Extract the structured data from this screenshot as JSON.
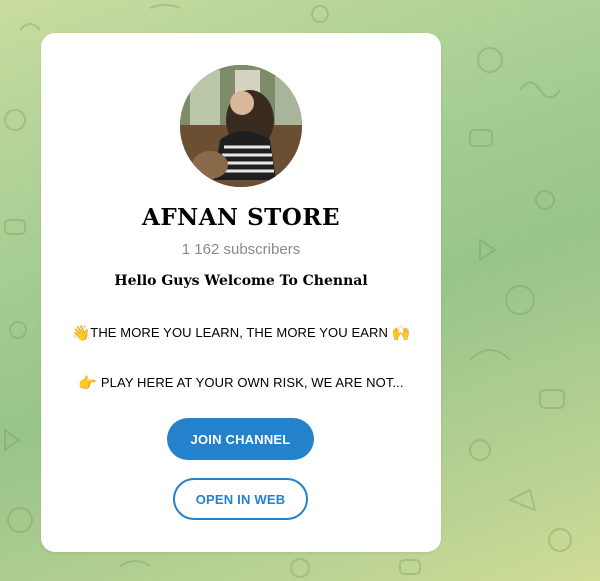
{
  "channel": {
    "name": "AFNAN STORE",
    "subscribers": "1 162 subscribers",
    "welcome": "Hello Guys Welcome To Chennal",
    "line1": {
      "emoji_start": "👋",
      "text": "THE MORE YOU LEARN, THE MORE YOU EARN",
      "emoji_end": "🙌"
    },
    "line2": {
      "emoji_start": "👉",
      "text": "PLAY HERE AT YOUR OWN RISK, WE ARE NOT..."
    }
  },
  "buttons": {
    "join": "JOIN CHANNEL",
    "web": "OPEN IN WEB"
  },
  "colors": {
    "accent": "#2481cc",
    "background": "#a9cf94"
  }
}
